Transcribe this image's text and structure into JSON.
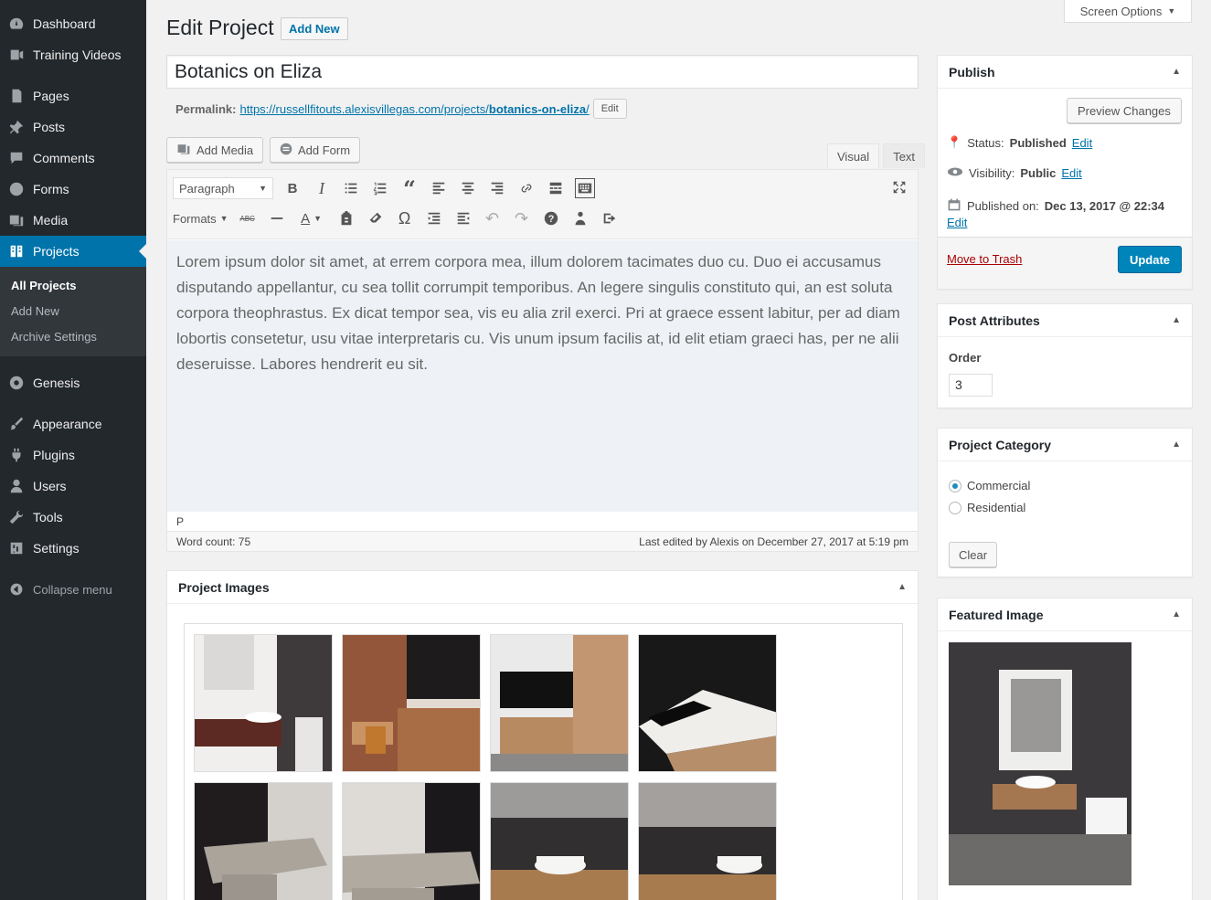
{
  "sidebar": {
    "items": [
      {
        "label": "Dashboard",
        "icon": "dashboard-icon"
      },
      {
        "label": "Training Videos",
        "icon": "video-icon"
      },
      {
        "label": "Pages",
        "icon": "pages-icon"
      },
      {
        "label": "Posts",
        "icon": "pin-icon"
      },
      {
        "label": "Comments",
        "icon": "comments-icon"
      },
      {
        "label": "Forms",
        "icon": "forms-icon"
      },
      {
        "label": "Media",
        "icon": "media-icon"
      },
      {
        "label": "Projects",
        "icon": "portfolio-icon"
      },
      {
        "label": "Genesis",
        "icon": "genesis-icon"
      },
      {
        "label": "Appearance",
        "icon": "brush-icon"
      },
      {
        "label": "Plugins",
        "icon": "plugin-icon"
      },
      {
        "label": "Users",
        "icon": "users-icon"
      },
      {
        "label": "Tools",
        "icon": "wrench-icon"
      },
      {
        "label": "Settings",
        "icon": "settings-icon"
      }
    ],
    "submenu": [
      "All Projects",
      "Add New",
      "Archive Settings"
    ],
    "collapse_label": "Collapse menu"
  },
  "header": {
    "title": "Edit Project",
    "add_new": "Add New",
    "screen_options": "Screen Options"
  },
  "post": {
    "title": "Botanics on Eliza",
    "permalink_label": "Permalink:",
    "permalink_base": "https://russellfitouts.alexisvillegas.com/projects/",
    "permalink_slug": "botanics-on-eliza",
    "permalink_end": "/",
    "edit_label": "Edit"
  },
  "editor": {
    "add_media": "Add Media",
    "add_form": "Add Form",
    "tab_visual": "Visual",
    "tab_text": "Text",
    "format_select": "Paragraph",
    "formats_menu": "Formats",
    "content": "Lorem ipsum dolor sit amet, at errem corpora mea, illum dolorem tacimates duo cu. Duo ei accusamus disputando appellantur, cu sea tollit corrumpit temporibus. An legere singulis constituto qui, an est soluta corpora theophrastus. Ex dicat tempor sea, vis eu alia zril exerci. Pri at graece essent labitur, per ad diam lobortis consetetur, usu vitae interpretaris cu. Vis unum ipsum facilis at, id elit etiam graeci has, per ne alii deseruisse. Labores hendrerit eu sit.",
    "path": "P",
    "word_count": "Word count: 75",
    "last_edited": "Last edited by Alexis on December 27, 2017 at 5:19 pm"
  },
  "project_images": {
    "title": "Project Images"
  },
  "publish": {
    "title": "Publish",
    "preview": "Preview Changes",
    "status_label": "Status:",
    "status_value": "Published",
    "visibility_label": "Visibility:",
    "visibility_value": "Public",
    "published_label": "Published on:",
    "published_value": "Dec 13, 2017 @ 22:34",
    "edit": "Edit",
    "trash": "Move to Trash",
    "update": "Update"
  },
  "attributes": {
    "title": "Post Attributes",
    "order_label": "Order",
    "order_value": "3"
  },
  "category": {
    "title": "Project Category",
    "options": [
      "Commercial",
      "Residential"
    ],
    "selected": "Commercial",
    "clear": "Clear"
  },
  "featured": {
    "title": "Featured Image"
  },
  "colors": {
    "accent": "#0073aa",
    "sidebar": "#23282d",
    "primary_button": "#0085ba"
  }
}
